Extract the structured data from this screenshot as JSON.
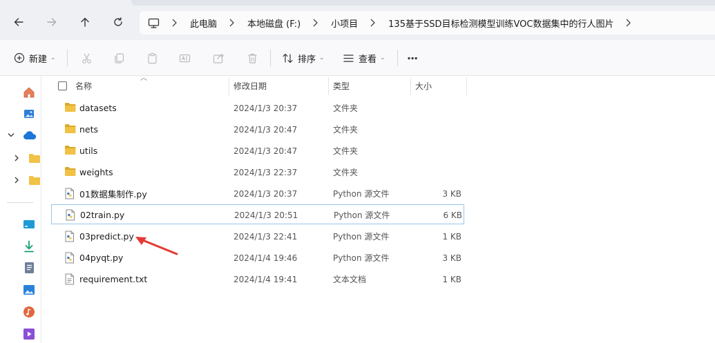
{
  "breadcrumbs": [
    "此电脑",
    "本地磁盘 (F:)",
    "小项目",
    "135基于SSD目标检测模型训练VOC数据集中的行人图片"
  ],
  "toolbar": {
    "new_label": "新建",
    "sort_label": "排序",
    "view_label": "查看",
    "more_label": "···"
  },
  "columns": {
    "name": "名称",
    "modified": "修改日期",
    "type": "类型",
    "size": "大小"
  },
  "files": [
    {
      "name": "datasets",
      "modified": "2024/1/3 20:37",
      "type": "文件夹",
      "size": "",
      "icon": "folder-icon"
    },
    {
      "name": "nets",
      "modified": "2024/1/3 20:47",
      "type": "文件夹",
      "size": "",
      "icon": "folder-icon"
    },
    {
      "name": "utils",
      "modified": "2024/1/3 20:47",
      "type": "文件夹",
      "size": "",
      "icon": "folder-icon"
    },
    {
      "name": "weights",
      "modified": "2024/1/3 22:37",
      "type": "文件夹",
      "size": "",
      "icon": "folder-icon"
    },
    {
      "name": "01数据集制作.py",
      "modified": "2024/1/3 20:37",
      "type": "Python 源文件",
      "size": "3 KB",
      "icon": "python-file-icon"
    },
    {
      "name": "02train.py",
      "modified": "2024/1/3 20:51",
      "type": "Python 源文件",
      "size": "6 KB",
      "icon": "python-file-icon",
      "selected": true
    },
    {
      "name": "03predict.py",
      "modified": "2024/1/3 22:41",
      "type": "Python 源文件",
      "size": "1 KB",
      "icon": "python-file-icon"
    },
    {
      "name": "04pyqt.py",
      "modified": "2024/1/4 19:46",
      "type": "Python 源文件",
      "size": "3 KB",
      "icon": "python-file-icon"
    },
    {
      "name": "requirement.txt",
      "modified": "2024/1/4 19:41",
      "type": "文本文档",
      "size": "1 KB",
      "icon": "text-file-icon"
    }
  ],
  "colors": {
    "folder": "#f0c246",
    "folder_dark": "#dba928",
    "selection_border": "#98c6ec",
    "annotation_arrow": "#e53935",
    "onedrive": "#1c75d8"
  }
}
